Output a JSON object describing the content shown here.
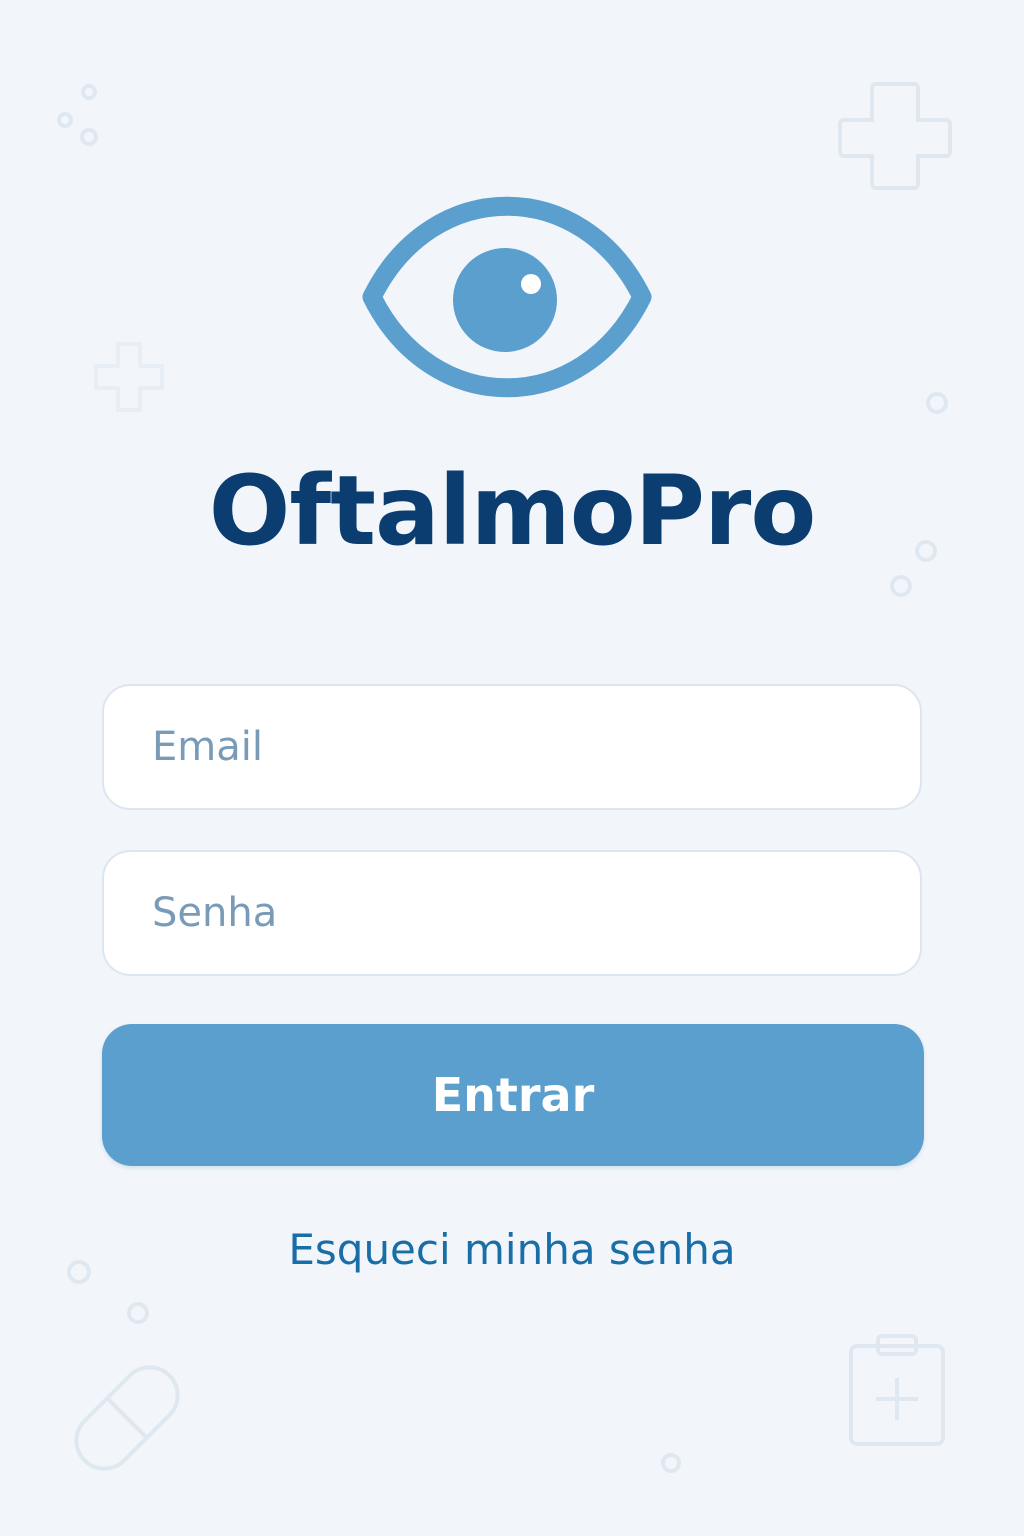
{
  "app": {
    "title": "OftalmoPro"
  },
  "login_form": {
    "email_placeholder": "Email",
    "password_placeholder": "Senha",
    "submit_label": "Entrar",
    "forgot_password_label": "Esqueci minha senha"
  },
  "icons": {
    "logo": "eye-icon",
    "decorations": [
      "medical-cross-icon",
      "pill-icon",
      "clipboard-icon",
      "bubble-icon"
    ]
  },
  "colors": {
    "background": "#f2f6fa",
    "brand_dark": "#0c3d70",
    "brand_accent": "#5a9fce",
    "link": "#1a6ea8",
    "placeholder": "#7a9bb8",
    "field_border": "#dce6f0"
  }
}
